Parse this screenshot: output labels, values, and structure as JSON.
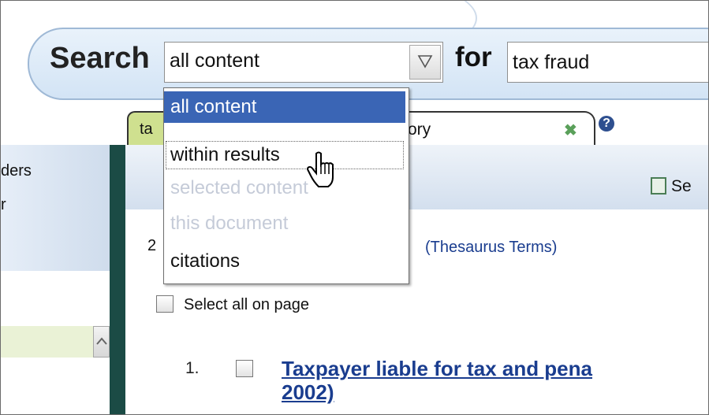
{
  "search": {
    "label": "Search",
    "scope_value": "all content",
    "for_label": "for",
    "query_value": "tax fraud"
  },
  "scope_options": [
    {
      "label": "all content",
      "state": "selected"
    },
    {
      "label": "within results",
      "state": "hover"
    },
    {
      "label": "selected content",
      "state": "disabled"
    },
    {
      "label": "this document",
      "state": "disabled"
    },
    {
      "label": "citations",
      "state": "normal"
    }
  ],
  "tabs": {
    "tab1_label": "ta",
    "tab2_label": "ory"
  },
  "left_panel": {
    "text1": "ders",
    "text2": "r"
  },
  "toolbar": {
    "select_label": "Se"
  },
  "results": {
    "count_text": "2",
    "thesaurus_link": "(Thesaurus Terms)",
    "select_all_label": "Select all on page",
    "items": [
      {
        "number": "1.",
        "title_line1": "Taxpayer liable for tax and pena",
        "title_line2": "2002)"
      }
    ]
  },
  "colors": {
    "accent": "#3a65b5",
    "link": "#1a3d8f",
    "divider": "#1b4b45"
  }
}
